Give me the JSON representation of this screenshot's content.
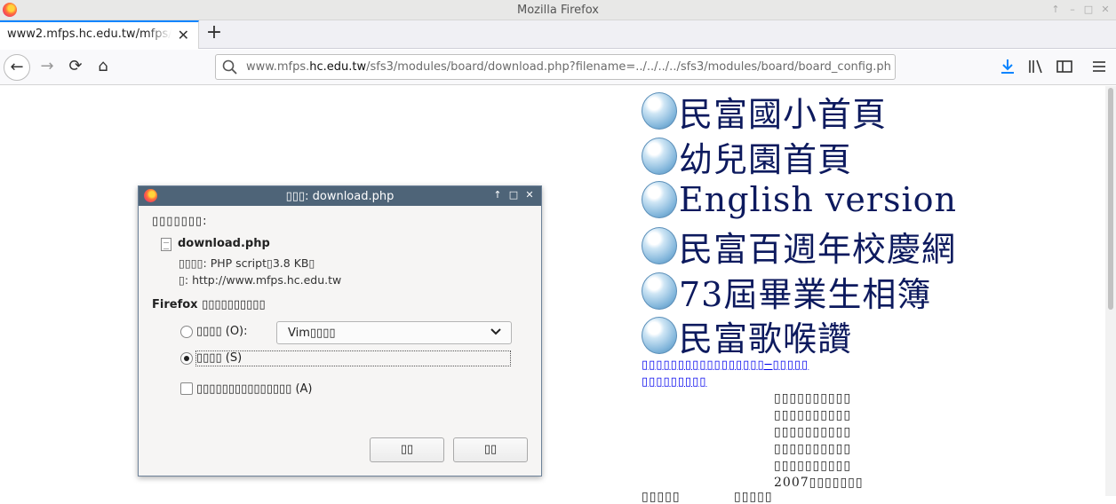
{
  "window": {
    "title": "Mozilla Firefox",
    "controls": [
      "↑",
      "–",
      "□",
      "✕"
    ]
  },
  "tab": {
    "title": "www2.mfps.hc.edu.tw/mfps/s",
    "close": "✕",
    "new_tab": "+"
  },
  "nav": {
    "back": "←",
    "forward": "→",
    "reload": "⟳",
    "home": "⌂",
    "url_prefix": "www.mfps.",
    "url_domain": "hc.edu.tw",
    "url_path": "/sfs3/modules/board/download.php?filename=../../../../sfs3/modules/board/board_config.php",
    "icons": {
      "downloads": "download-icon",
      "library": "library-icon",
      "sidebar": "sidebar-icon",
      "menu": "menu-icon"
    },
    "accent_color": "#0a84ff"
  },
  "page": {
    "menu": [
      "民富國小首頁",
      "幼兒園首頁",
      "English version",
      "民富百週年校慶網",
      "73屆畢業生相簿",
      "民富歌喉讚"
    ],
    "news_link_1": "▯▯▯▯▯▯▯▯▯▯▯▯▯▯▯▯▯─▯▯▯▯▯",
    "news_link_2": "▯▯▯▯▯▯▯▯▯",
    "right_lines": [
      "▯▯▯▯▯▯▯▯▯▯",
      "▯▯▯▯▯▯▯▯▯▯",
      "▯▯▯▯▯▯▯▯▯▯",
      "▯▯▯▯▯▯▯▯▯▯",
      "▯▯▯▯▯▯▯▯▯▯",
      "2007▯▯▯▯▯▯▯"
    ],
    "bottom_left": "▯▯▯▯▯",
    "bottom_mid": "▯▯▯▯▯"
  },
  "dialog": {
    "title": "▯▯▯: download.php",
    "opening_label": "▯▯▯▯▯▯▯:",
    "file_name": "download.php",
    "file_type": "▯▯▯▯: PHP script▯3.8 KB▯",
    "file_from": "▯: http://www.mfps.hc.edu.tw",
    "question": "Firefox ▯▯▯▯▯▯▯▯▯▯",
    "open_with_label": "▯▯▯▯ (O):",
    "open_with_app": "Vim▯▯▯▯",
    "save_label": "▯▯▯▯ (S)",
    "remember_label": "▯▯▯▯▯▯▯▯▯▯▯▯▯▯▯ (A)",
    "cancel_button": "▯▯",
    "ok_button": "▯▯",
    "title_controls": [
      "↑",
      "□",
      "✕"
    ]
  }
}
